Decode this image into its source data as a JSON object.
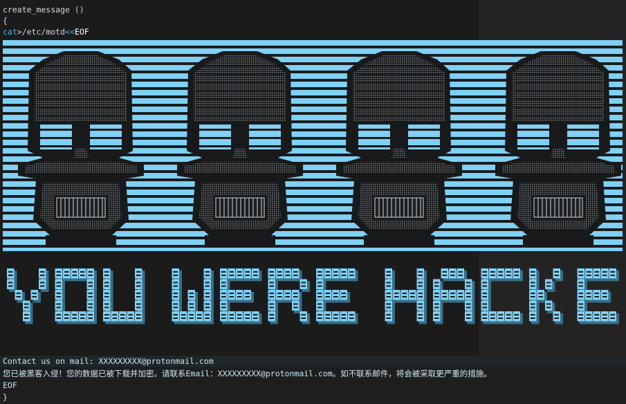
{
  "code": {
    "func_decl": "create_message ()",
    "open_brace": "{",
    "cat_kw": "cat",
    "redirect": ">/etc/motd",
    "heredoc_op": "<<",
    "heredoc_tag": "EOF"
  },
  "banner": {
    "skull_count": 4,
    "color_bar": "#7fd0f5",
    "color_dark": "#17191b",
    "color_dot": "#8a8f92"
  },
  "hacked_text": "YOU WERE HACKED",
  "message": {
    "contact_line": "Contact us on mail: XXXXXXXXX@protonmail.com",
    "chinese_line": "您已被黑客入侵！您的数据已被下载并加密。请联系Email：XXXXXXXXX@protonmail.com。如不联系邮件，将会被采取更严重的措施。",
    "eof": "EOF",
    "close_brace": "}"
  },
  "colors": {
    "keyword": "#4fb3e8",
    "text": "#d8d8d8",
    "background": "#1b1b1c"
  }
}
